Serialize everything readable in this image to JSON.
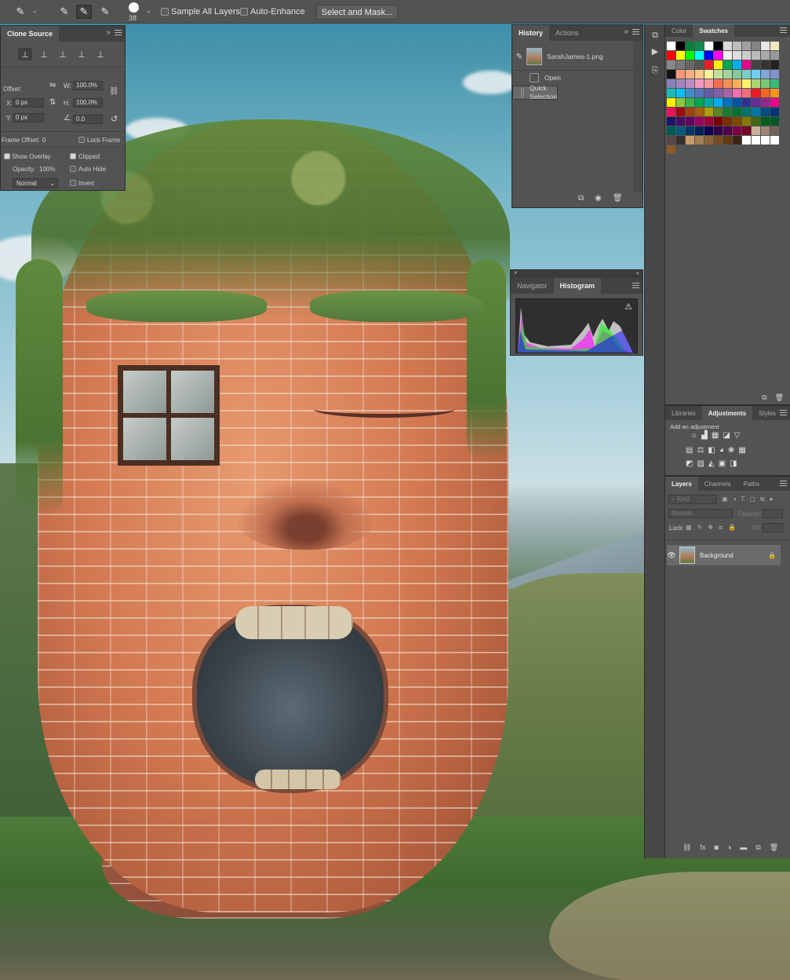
{
  "options_bar": {
    "brush_size": "38",
    "sample_all_layers_label": "Sample All Layers",
    "sample_all_layers_checked": false,
    "auto_enhance_label": "Auto-Enhance",
    "auto_enhance_checked": false,
    "select_mask_label": "Select and Mask..."
  },
  "clone_source": {
    "title": "Clone Source",
    "offset_label": "Offset:",
    "x_label": "X:",
    "x_value": "0 px",
    "y_label": "Y:",
    "y_value": "0 px",
    "w_label": "W:",
    "w_value": "100.0%",
    "h_label": "H:",
    "h_value": "100.0%",
    "angle_value": "0.0",
    "frame_offset_label": "Frame Offset:",
    "frame_offset_value": "0",
    "lock_frame_label": "Lock Frame",
    "show_overlay_label": "Show Overlay",
    "show_overlay_checked": true,
    "clipped_label": "Clipped",
    "clipped_checked": true,
    "opacity_label": "Opacity:",
    "opacity_value": "100%",
    "auto_hide_label": "Auto Hide",
    "blend_mode": "Normal",
    "invert_label": "Invert"
  },
  "history": {
    "tabs": [
      "History",
      "Actions"
    ],
    "snapshot": "SarahJames-1.png",
    "states": [
      "Open",
      "Quick Selection"
    ]
  },
  "navigator": {
    "tabs": [
      "Navigator",
      "Histogram"
    ],
    "warning_icon": "warning-icon"
  },
  "color_panel": {
    "tabs": [
      "Color",
      "Swatches"
    ],
    "swatches": [
      "#ffffff",
      "#000000",
      "#0a7f3a",
      "#138a4c",
      "#ffffff",
      "#000000",
      "#d9d9d9",
      "#bdbdbd",
      "#a0a0a0",
      "#848484",
      "#e6e6e6",
      "#f2e8c0",
      "#ff0000",
      "#ffff00",
      "#00ff00",
      "#00ffff",
      "#0000ff",
      "#ff00ff",
      "#eeeeee",
      "#dddddd",
      "#cccccc",
      "#bbbbbb",
      "#aaaaaa",
      "#999999",
      "#888888",
      "#777777",
      "#666666",
      "#555555",
      "#ed1c24",
      "#fff200",
      "#00a651",
      "#00aeef",
      "#ec008c",
      "#444444",
      "#333333",
      "#222222",
      "#111111",
      "#f7977a",
      "#f9ad81",
      "#fdc68a",
      "#fff79a",
      "#c4df9b",
      "#a3d39c",
      "#82ca9d",
      "#7bcdc8",
      "#6ecff6",
      "#7ea7d8",
      "#8393ca",
      "#8781bd",
      "#a187be",
      "#bc8dbf",
      "#f49ac2",
      "#f6989d",
      "#f26c4f",
      "#f68e55",
      "#fbaf5d",
      "#fff467",
      "#acd372",
      "#7cc576",
      "#3bb878",
      "#1abbb4",
      "#00bff3",
      "#438ccb",
      "#5574b9",
      "#605ca8",
      "#855fa8",
      "#a763a8",
      "#f06ea9",
      "#f26d7d",
      "#ed1c24",
      "#f26522",
      "#f7941d",
      "#fff200",
      "#8dc73f",
      "#39b54a",
      "#00a651",
      "#00a99d",
      "#00aeef",
      "#0072bc",
      "#0054a6",
      "#2e3192",
      "#662d91",
      "#92278f",
      "#ec008c",
      "#ed145b",
      "#9e0b0f",
      "#a0410d",
      "#a36209",
      "#aba000",
      "#598527",
      "#1a7b30",
      "#007236",
      "#00746b",
      "#0076a3",
      "#004b80",
      "#003471",
      "#1b1464",
      "#440e62",
      "#630460",
      "#9e005d",
      "#9e0039",
      "#790000",
      "#7b2e00",
      "#7d4900",
      "#827b00",
      "#406618",
      "#005e20",
      "#005826",
      "#005952",
      "#005b7f",
      "#003663",
      "#002157",
      "#0d004c",
      "#32004b",
      "#4b0049",
      "#7b0046",
      "#7a0026",
      "#c7b299",
      "#998675",
      "#736357",
      "#534741",
      "#37302d",
      "#c69c6d",
      "#a67c52",
      "#8c6239",
      "#754c24",
      "#603913",
      "#3c2415",
      "#ffffff",
      "#ffffff",
      "#ffffff",
      "#ffffff",
      "#8b5a2b"
    ]
  },
  "adjustments": {
    "tabs": [
      "Libraries",
      "Adjustments",
      "Styles"
    ],
    "hint": "Add an adjustment"
  },
  "layers": {
    "tabs": [
      "Layers",
      "Channels",
      "Paths"
    ],
    "kind_label": "Kind",
    "blend_mode": "Normal",
    "opacity_label": "Opacity:",
    "lock_label": "Lock:",
    "fill_label": "Fill:",
    "layer_name": "Background"
  },
  "colors": {
    "panel_bg": "#535353",
    "tab_bg": "#424242",
    "selection_bg": "#6a6a6a"
  }
}
